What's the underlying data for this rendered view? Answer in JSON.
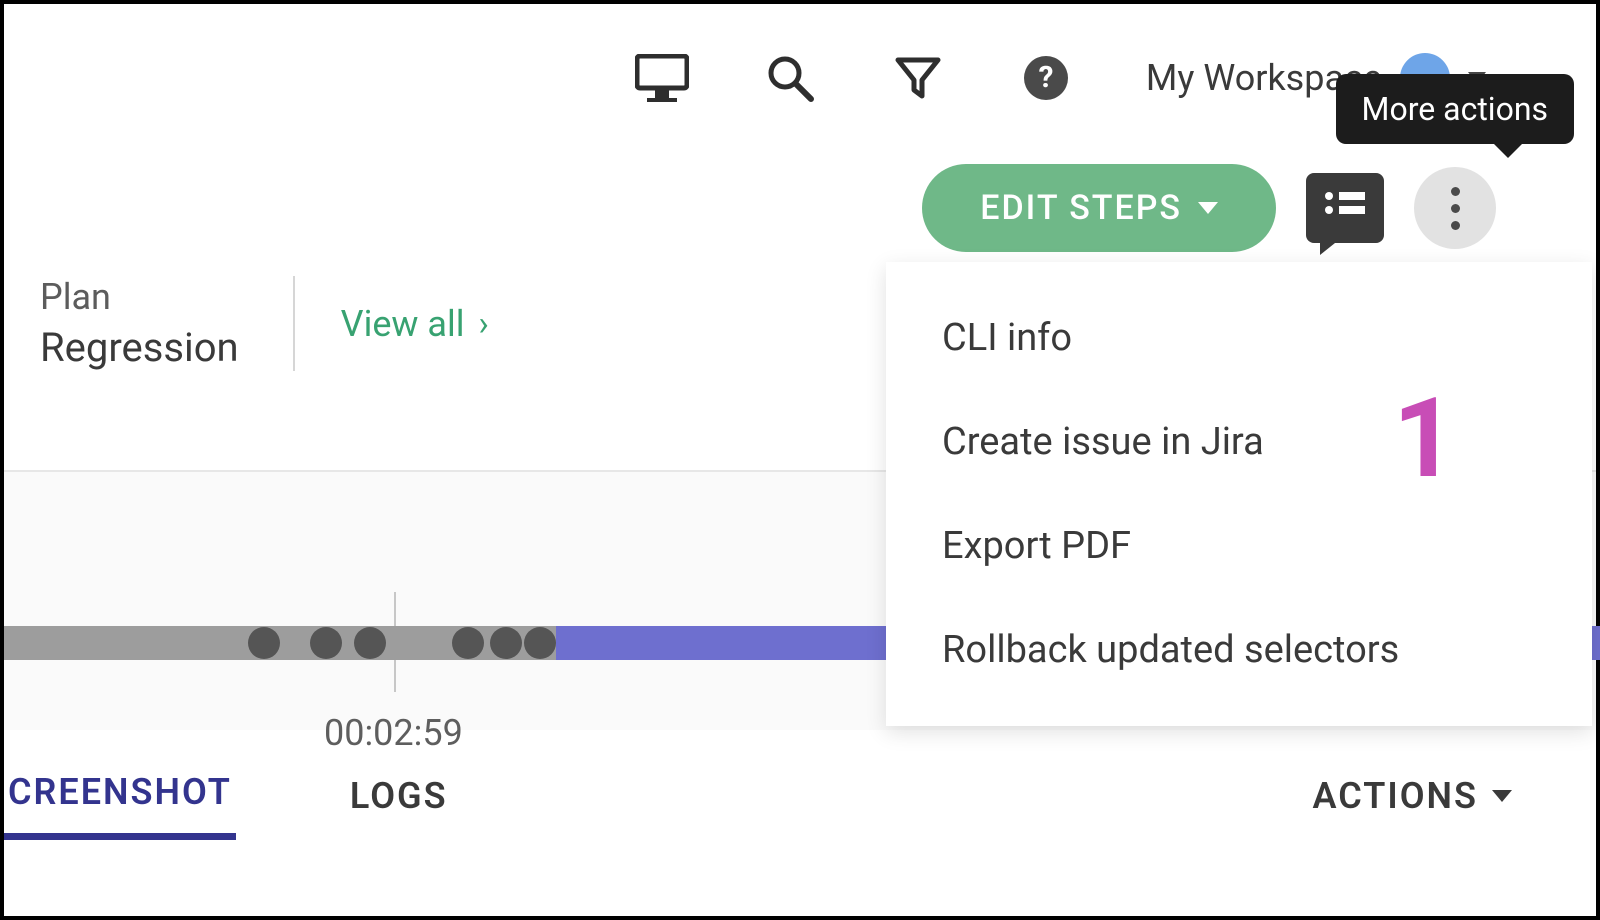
{
  "topbar": {
    "workspace_label": "My Workspace"
  },
  "tooltip": {
    "more_actions": "More actions"
  },
  "actionrow": {
    "edit_steps": "EDIT STEPS"
  },
  "info": {
    "plan_label": "Plan",
    "plan_value": "Regression",
    "view_all": "View all"
  },
  "timeline": {
    "tick_label": "00:02:59"
  },
  "tabs": {
    "screenshot": "CREENSHOT",
    "logs": "LOGS",
    "actions": "ACTIONS"
  },
  "menu": {
    "items": [
      "CLI info",
      "Create issue in Jira",
      "Export PDF",
      "Rollback updated selectors"
    ]
  },
  "annotation": {
    "one": "1"
  }
}
